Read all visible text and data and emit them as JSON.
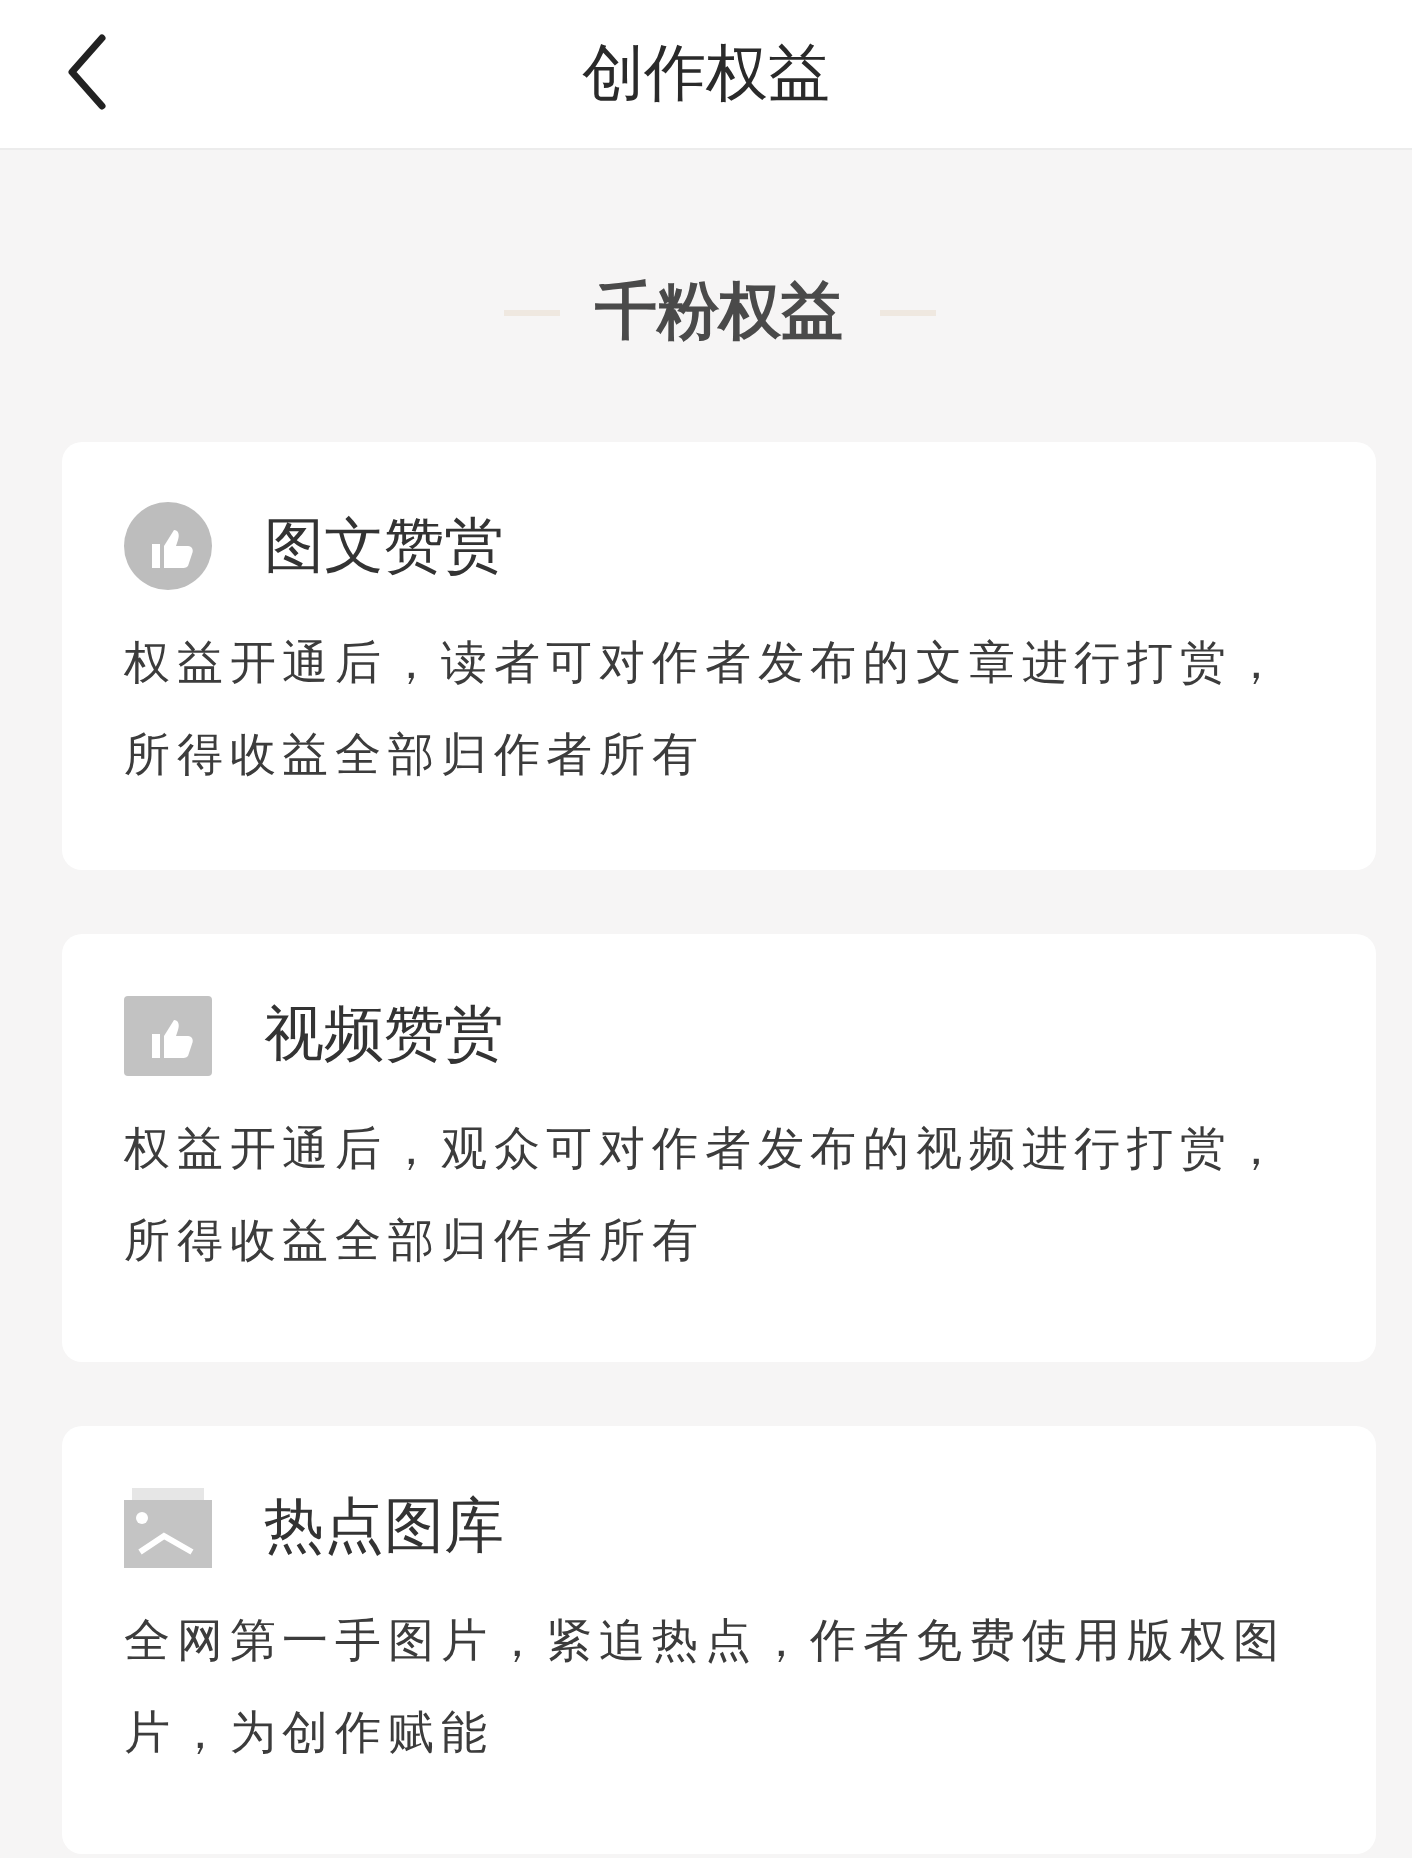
{
  "header": {
    "title": "创作权益"
  },
  "section_title": "千粉权益",
  "benefits": [
    {
      "kind": "circle-thumb",
      "title": "图文赞赏",
      "description": "权益开通后，读者可对作者发布的文章进行打赏，所得收益全部归作者所有"
    },
    {
      "kind": "square-thumb",
      "title": "视频赞赏",
      "description": "权益开通后，观众可对作者发布的视频进行打赏，所得收益全部归作者所有"
    },
    {
      "kind": "image",
      "title": "热点图库",
      "description": "全网第一手图片，紧追热点，作者免费使用版权图片，为创作赋能"
    }
  ]
}
